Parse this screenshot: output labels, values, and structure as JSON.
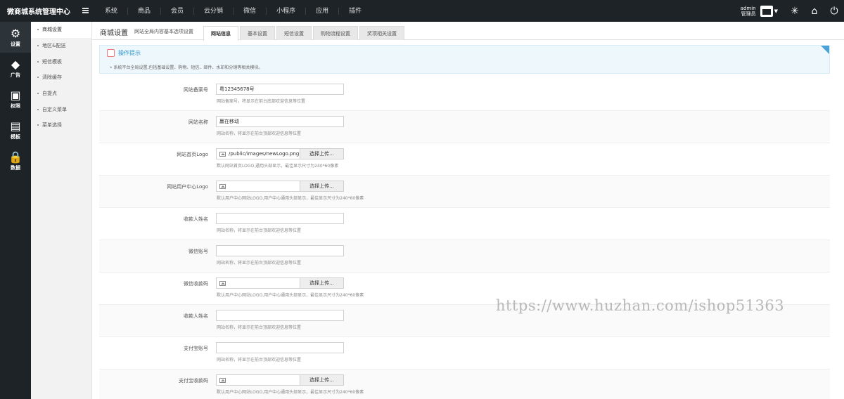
{
  "header": {
    "brand": "微商城系统管理中心",
    "nav": [
      "系统",
      "商品",
      "会员",
      "云分销",
      "微信",
      "小程序",
      "应用",
      "插件"
    ],
    "admin_name": "admin",
    "admin_role": "管理员"
  },
  "iconbar": [
    {
      "label": "设置",
      "icon": "gear-icon",
      "glyph": "⚙"
    },
    {
      "label": "广告",
      "icon": "diamond-icon",
      "glyph": "◆"
    },
    {
      "label": "权限",
      "icon": "ad-screen-icon",
      "glyph": "▣"
    },
    {
      "label": "模板",
      "icon": "document-icon",
      "glyph": "▤"
    },
    {
      "label": "数据",
      "icon": "lock-icon",
      "glyph": "🔒"
    }
  ],
  "submenu": [
    "商城设置",
    "地区&配送",
    "短信模板",
    "清除缓存",
    "自提点",
    "自定义菜单",
    "菜单选择"
  ],
  "page": {
    "title": "商城设置",
    "subtitle": "网站全局内容基本选项设置",
    "tabs": [
      "网站信息",
      "基本设置",
      "短信设置",
      "购物流程设置",
      "奖项相关设置"
    ]
  },
  "tip": {
    "title": "操作提示",
    "text": "系统平台全局设置,包括基础设置、购物、短信、邮件、水印和分销等相关模块。"
  },
  "form": {
    "rows": [
      {
        "label": "网站备案号",
        "type": "text",
        "value": "粤12345678号",
        "hint": "网站备案号，将显示在前台底部欢迎信息等位置"
      },
      {
        "label": "网站名称",
        "type": "text",
        "value": "赢在移动",
        "hint": "网站名称，将显示在前台顶部欢迎信息等位置"
      },
      {
        "label": "网站首页Logo",
        "type": "file",
        "value": "/public/images/newLogo.png",
        "button": "选择上传...",
        "hint": "默认网站首页LOGO,通用头部显示，最佳显示尺寸为240*60像素"
      },
      {
        "label": "网站用户中心Logo",
        "type": "file",
        "value": "",
        "button": "选择上传...",
        "hint": "默认用户中心网站LOGO,用户中心通用头部显示，最佳显示尺寸为240*60像素"
      },
      {
        "label": "收款人姓名",
        "type": "text",
        "value": "",
        "hint": "网站名称，将显示在前台顶部欢迎信息等位置"
      },
      {
        "label": "微信账号",
        "type": "text",
        "value": "",
        "hint": "网站名称，将显示在前台顶部欢迎信息等位置"
      },
      {
        "label": "微信收款码",
        "type": "file",
        "value": "",
        "button": "选择上传...",
        "hint": "默认用户中心网站LOGO,用户中心通用头部显示，最佳显示尺寸为240*60像素"
      },
      {
        "label": "收款人姓名",
        "type": "text",
        "value": "",
        "hint": "网站名称，将显示在前台顶部欢迎信息等位置"
      },
      {
        "label": "支付宝账号",
        "type": "text",
        "value": "",
        "hint": "网站名称，将显示在前台顶部欢迎信息等位置"
      },
      {
        "label": "支付宝收款码",
        "type": "file",
        "value": "",
        "button": "选择上传...",
        "hint": "默认用户中心网站LOGO,用户中心通用头部显示，最佳显示尺寸为240*60像素"
      }
    ]
  },
  "watermark": "https://www.huzhan.com/ishop51363"
}
